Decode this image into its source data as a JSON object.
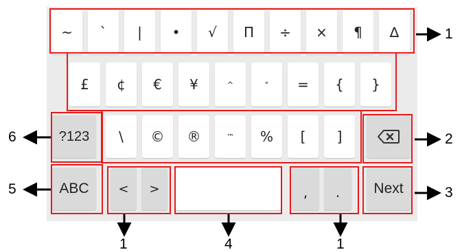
{
  "keyboard": {
    "row1": [
      "~",
      "`",
      "|",
      "•",
      "√",
      "Π",
      "÷",
      "×",
      "¶",
      "∆"
    ],
    "row2": [
      "£",
      "¢",
      "€",
      "¥",
      "^",
      "°",
      "=",
      "{",
      "}"
    ],
    "row3": [
      "\\",
      "©",
      "®",
      "™",
      "%",
      "[",
      "]"
    ],
    "mode_symbols_label": "?123",
    "mode_abc_label": "ABC",
    "less_than": "<",
    "greater_than": ">",
    "comma": ",",
    "period": ".",
    "next_label": "Next",
    "backspace_icon": "backspace-icon"
  },
  "callouts": {
    "row1": "1",
    "backspace": "2",
    "next": "3",
    "abc": "5",
    "mode": "6",
    "angle": "1",
    "space": "4",
    "punct": "1"
  },
  "colors": {
    "annotation": "#e41b1b",
    "keyboard_bg": "#ebebeb",
    "key_light": "#ffffff",
    "key_dark": "#dadada"
  }
}
